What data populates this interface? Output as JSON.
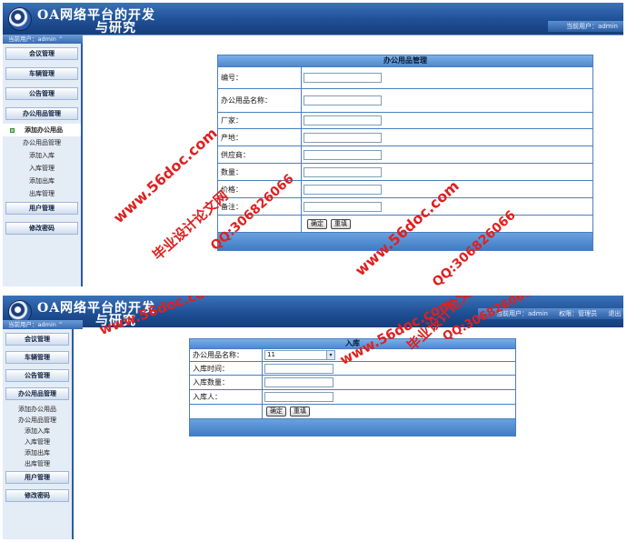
{
  "app": {
    "title_line1": "OA网络平台的开发",
    "title_line2": "与研究",
    "current_user": "当前用户：admin"
  },
  "shot1": {
    "banner_right": [
      "当前用户：admin"
    ],
    "sidebar": {
      "sections": [
        "会议管理",
        "车辆管理",
        "公告管理",
        "办公用品管理"
      ],
      "subitems": [
        "添加办公用品",
        "办公用品管理",
        "添加入库",
        "入库管理",
        "添加出库",
        "出库管理"
      ],
      "active_index": 0,
      "after": [
        "用户管理",
        "修改密码"
      ]
    },
    "form": {
      "title": "办公用品管理",
      "fields": [
        "编号：",
        "办公用品名称：",
        "厂家：",
        "产地：",
        "供应商：",
        "数量：",
        "价格：",
        "备注："
      ],
      "submit": "确定",
      "reset": "重填"
    }
  },
  "shot2": {
    "banner_right": [
      "当前用户：admin",
      "权限：管理员",
      "退出"
    ],
    "sidebar": {
      "sections": [
        "会议管理",
        "车辆管理",
        "公告管理",
        "办公用品管理"
      ],
      "subitems": [
        "添加办公用品",
        "办公用品管理",
        "添加入库",
        "入库管理",
        "添加出库",
        "出库管理"
      ],
      "after": [
        "用户管理",
        "修改密码"
      ]
    },
    "form": {
      "title": "入库",
      "fields": [
        "办公用品名称：",
        "入库时间：",
        "入库数量：",
        "入库人："
      ],
      "select_value": "11",
      "submit": "确定",
      "reset": "重填"
    }
  },
  "watermark": {
    "brand": "毕业设计论文网",
    "site": "www.56doc.com",
    "qq": "QQ:306826066"
  }
}
